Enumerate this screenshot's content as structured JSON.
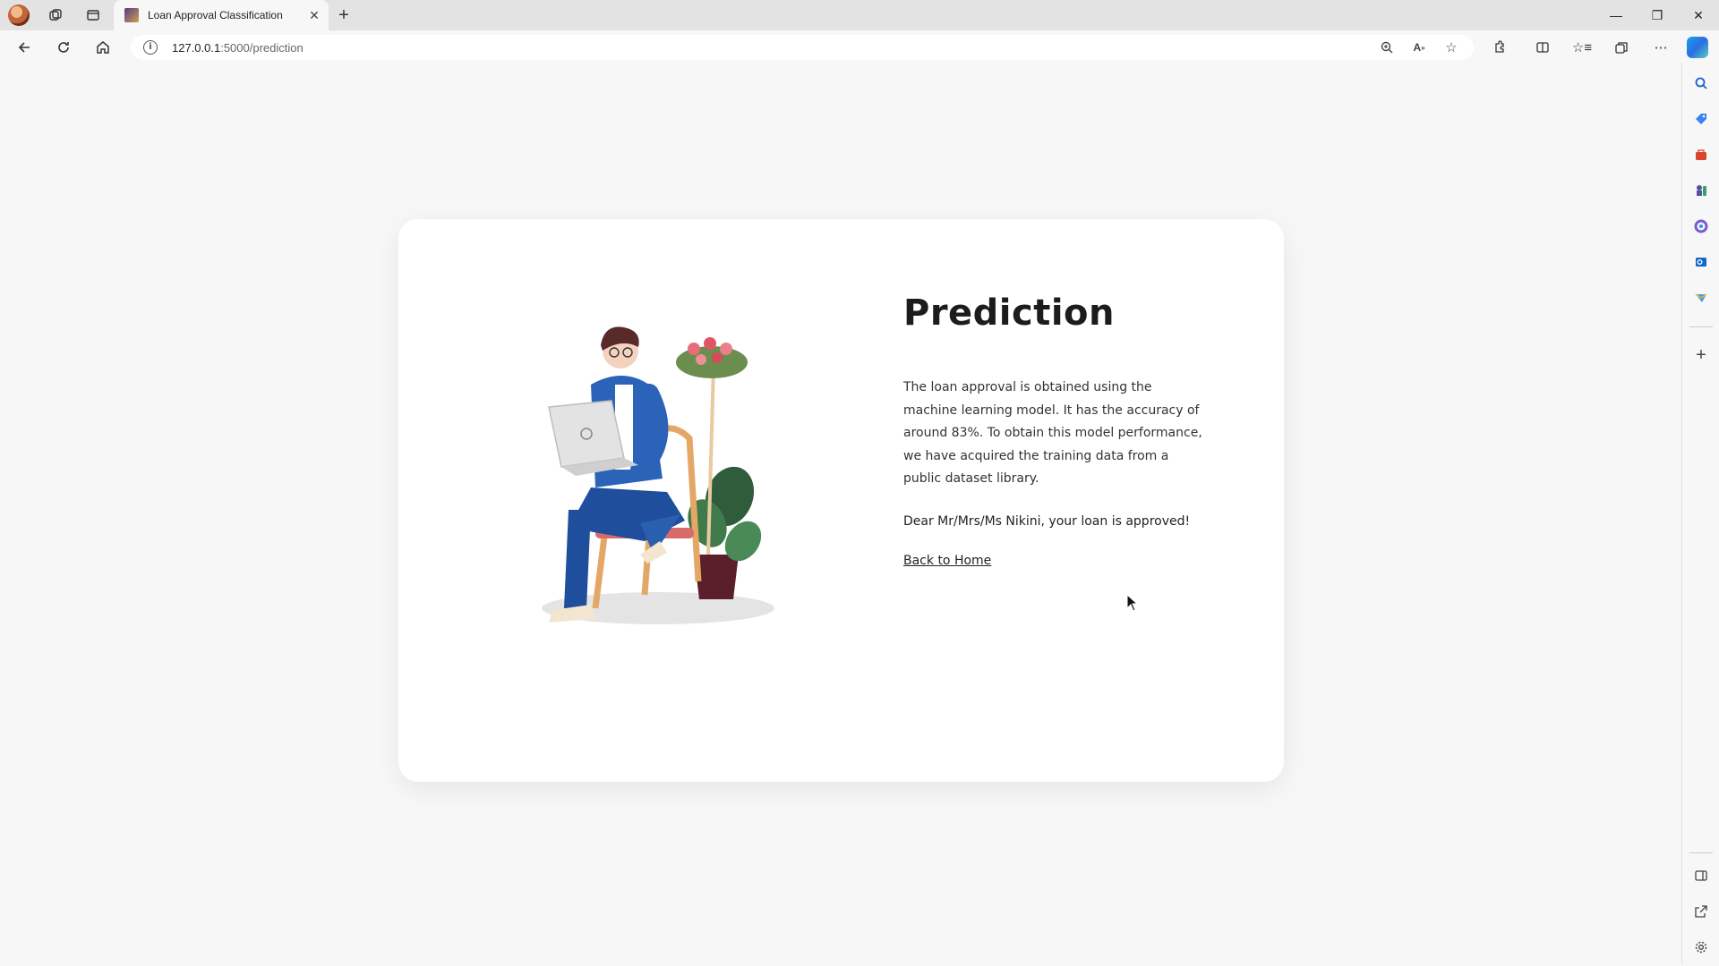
{
  "browser": {
    "tab_title": "Loan Approval Classification",
    "tab_close": "✕",
    "new_tab": "+",
    "url_host": "127.0.0.1",
    "url_path": ":5000/prediction",
    "window": {
      "minimize": "—",
      "restore": "❐",
      "close": "✕"
    }
  },
  "page": {
    "heading": "Prediction",
    "description": "The loan approval is obtained using the machine learning model. It has the accuracy of around 83%. To obtain this model performance, we have acquired the training data from a public dataset library.",
    "result": "Dear Mr/Mrs/Ms Nikini, your loan is approved!",
    "back_link": "Back to Home"
  },
  "icons": {
    "toolbar": [
      "back-icon",
      "refresh-icon",
      "home-icon",
      "info-icon",
      "zoom-icon",
      "read-aloud-icon",
      "favorite-icon",
      "extensions-icon",
      "split-screen-icon",
      "favorites-icon",
      "collections-icon",
      "more-icon",
      "copilot-icon"
    ],
    "sidebar": [
      "search-icon",
      "shopping-icon",
      "tools-icon",
      "games-icon",
      "office-icon",
      "outlook-icon",
      "drop-icon",
      "add-icon",
      "sidebar-toggle-icon",
      "external-icon",
      "settings-icon"
    ]
  },
  "colors": {
    "accent": "#1a73e8",
    "card": "#ffffff",
    "page_bg": "#f7f7f7"
  }
}
